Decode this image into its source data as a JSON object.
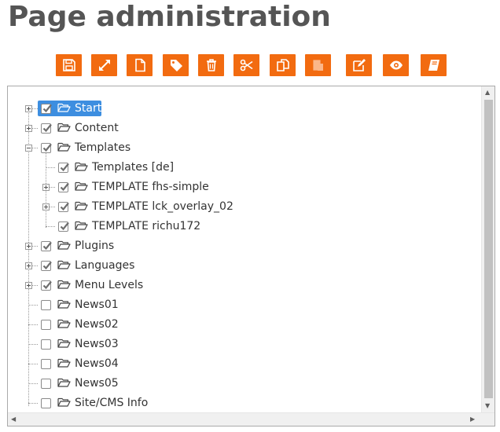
{
  "page": {
    "title": "Page administration"
  },
  "toolbar": {
    "buttons": [
      {
        "icon": "save-icon"
      },
      {
        "icon": "expand-icon"
      },
      {
        "icon": "new-page-icon"
      },
      {
        "icon": "tag-icon"
      },
      {
        "icon": "trash-icon"
      },
      {
        "icon": "scissors-icon"
      },
      {
        "icon": "copy-icon"
      },
      {
        "icon": "paste-icon"
      },
      {
        "icon": "edit-icon"
      },
      {
        "icon": "eye-icon"
      },
      {
        "icon": "book-icon"
      }
    ],
    "color": "#f26b10"
  },
  "tree": {
    "selection_color": "#3d8ee0",
    "nodes": [
      {
        "label": "Start",
        "level": 0,
        "expander": "plus",
        "checked": true,
        "selected": true
      },
      {
        "label": "Content",
        "level": 0,
        "expander": "plus",
        "checked": true
      },
      {
        "label": "Templates",
        "level": 0,
        "expander": "minus",
        "checked": true
      },
      {
        "label": "Templates [de]",
        "level": 1,
        "expander": "none",
        "checked": true
      },
      {
        "label": "TEMPLATE fhs-simple",
        "level": 1,
        "expander": "plus",
        "checked": true
      },
      {
        "label": "TEMPLATE lck_overlay_02",
        "level": 1,
        "expander": "plus",
        "checked": true
      },
      {
        "label": "TEMPLATE richu172",
        "level": 1,
        "expander": "none",
        "checked": true
      },
      {
        "label": "Plugins",
        "level": 0,
        "expander": "plus",
        "checked": true
      },
      {
        "label": "Languages",
        "level": 0,
        "expander": "plus",
        "checked": true
      },
      {
        "label": "Menu Levels",
        "level": 0,
        "expander": "plus",
        "checked": true
      },
      {
        "label": "News01",
        "level": 0,
        "expander": "none",
        "checked": false
      },
      {
        "label": "News02",
        "level": 0,
        "expander": "none",
        "checked": false
      },
      {
        "label": "News03",
        "level": 0,
        "expander": "none",
        "checked": false
      },
      {
        "label": "News04",
        "level": 0,
        "expander": "none",
        "checked": false
      },
      {
        "label": "News05",
        "level": 0,
        "expander": "none",
        "checked": false
      },
      {
        "label": "Site/CMS Info",
        "level": 0,
        "expander": "none",
        "checked": false
      }
    ]
  }
}
